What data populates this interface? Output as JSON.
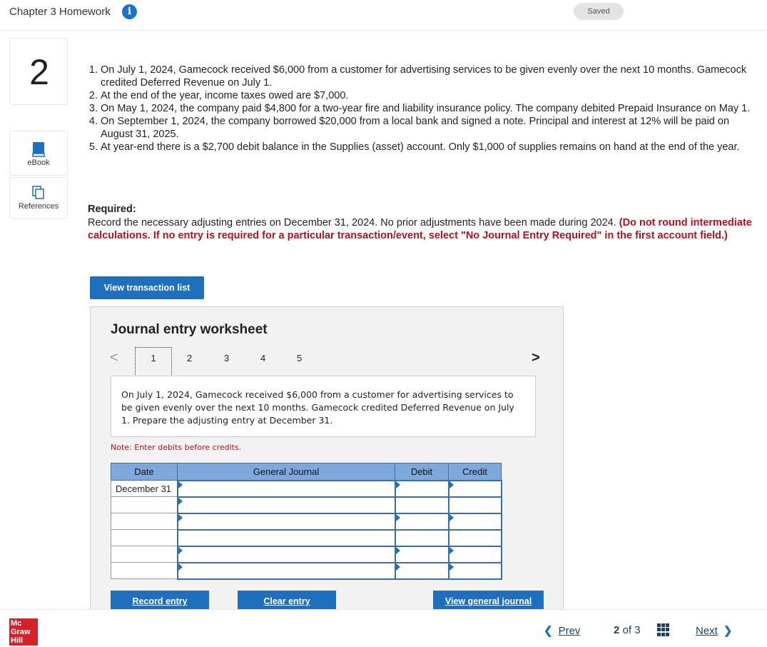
{
  "header": {
    "title": "Chapter 3 Homework",
    "saved_label": "Saved"
  },
  "question_number": "2",
  "sidebar": {
    "ebook_label": "eBook",
    "references_label": "References"
  },
  "items": [
    "On July 1, 2024, Gamecock received $6,000 from a customer for advertising services to be given evenly over the next 10 months. Gamecock credited Deferred Revenue on July 1.",
    "At the end of the year, income taxes owed are $7,000.",
    "On May 1, 2024, the company paid $4,800 for a two-year fire and liability insurance policy. The company debited Prepaid Insurance on May 1.",
    "On September 1, 2024, the company borrowed $20,000 from a local bank and signed a note. Principal and interest at 12% will be paid on August 31, 2025.",
    "At year-end there is a $2,700 debit balance in the Supplies (asset) account. Only $1,000 of supplies remains on hand at the end of the year."
  ],
  "required": {
    "title": "Required:",
    "text": "Record the necessary adjusting entries on December 31, 2024. No prior adjustments have been made during 2024. ",
    "bold_text": "(Do not round intermediate calculations. If no entry is required for a particular transaction/event, select \"No Journal Entry Required\" in the first account field.)"
  },
  "view_transaction_label": "View transaction list",
  "worksheet": {
    "title": "Journal entry worksheet",
    "tabs": [
      "1",
      "2",
      "3",
      "4",
      "5"
    ],
    "prev_glyph": "<",
    "next_glyph": ">",
    "description": "On July 1, 2024, Gamecock received $6,000 from a customer for advertising services to be given evenly over the next 10 months. Gamecock credited Deferred Revenue on July 1. Prepare the adjusting entry at December 31.",
    "note": "Note: Enter debits before credits.",
    "columns": [
      "Date",
      "General Journal",
      "Debit",
      "Credit"
    ],
    "rows": [
      {
        "date": "December 31",
        "account": "",
        "debit": "",
        "credit": ""
      },
      {
        "date": "",
        "account": "",
        "debit": "",
        "credit": ""
      },
      {
        "date": "",
        "account": "",
        "debit": "",
        "credit": ""
      },
      {
        "date": "",
        "account": "",
        "debit": "",
        "credit": ""
      },
      {
        "date": "",
        "account": "",
        "debit": "",
        "credit": ""
      },
      {
        "date": "",
        "account": "",
        "debit": "",
        "credit": ""
      }
    ],
    "record_label": "Record entry",
    "clear_label": "Clear entry",
    "view_journal_label": "View general journal"
  },
  "footer": {
    "logo_lines": [
      "Mc",
      "Graw",
      "Hill"
    ],
    "prev_label": "Prev",
    "page_current": "2",
    "page_of": "of",
    "page_total": "3",
    "next_label": "Next"
  }
}
